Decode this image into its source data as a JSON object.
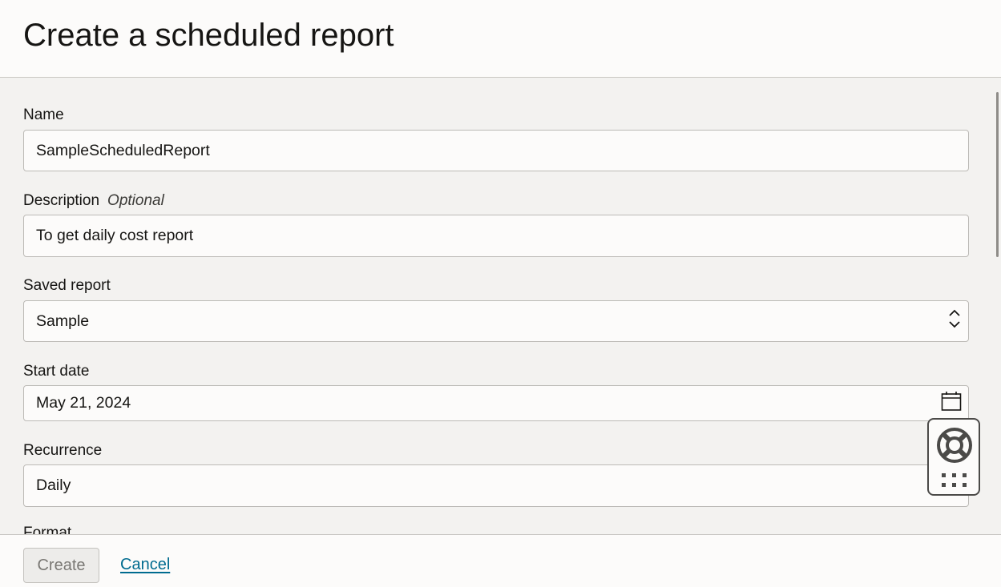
{
  "page": {
    "title": "Create a scheduled report"
  },
  "form": {
    "name": {
      "label": "Name",
      "value": "SampleScheduledReport"
    },
    "description": {
      "label": "Description",
      "optional_text": "Optional",
      "value": "To get daily cost report"
    },
    "saved_report": {
      "label": "Saved report",
      "value": "Sample"
    },
    "start_date": {
      "label": "Start date",
      "value": "May 21, 2024"
    },
    "recurrence": {
      "label": "Recurrence",
      "value": "Daily"
    },
    "format": {
      "label": "Format"
    }
  },
  "footer": {
    "create_label": "Create",
    "cancel_label": "Cancel"
  },
  "icons": {
    "select": "chevron-up-down-icon",
    "calendar": "calendar-icon",
    "help": "lifebuoy-icon",
    "apps": "grid-dots-icon"
  },
  "colors": {
    "link": "#006b8f",
    "background": "#f3f2f0",
    "surface": "#fcfbfa"
  }
}
